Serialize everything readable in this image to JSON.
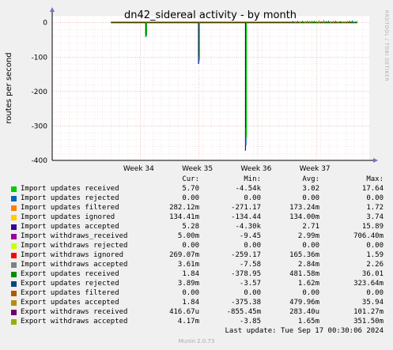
{
  "chart_data": {
    "type": "line",
    "title": "dn42_sidereal activity - by month",
    "ylabel": "routes per second",
    "ylim": [
      -400,
      20
    ],
    "yticks": [
      0,
      -100,
      -200,
      -300,
      -400
    ],
    "xticks": [
      "Week 34",
      "Week 35",
      "Week 36",
      "Week 37"
    ],
    "side_label": "RRDTOOL / TOBI OETIKER",
    "spikes": [
      {
        "week": 34.1,
        "min": -42,
        "colors": [
          "#00cc00",
          "#0066b3",
          "#00cc00"
        ]
      },
      {
        "week": 35.0,
        "min": -120,
        "colors": [
          "#330099",
          "#0066b3",
          "#00cc00"
        ]
      },
      {
        "week": 35.8,
        "min": -372,
        "colors": [
          "#330099",
          "#0066b3",
          "#00cc00"
        ]
      }
    ],
    "baseline_week_start": 33.5,
    "baseline_week_end": 37.7,
    "series": [
      {
        "name": "Import updates received",
        "color": "#00cc00",
        "cur": "5.70",
        "min": "-4.54k",
        "avg": "3.02",
        "max": "17.64"
      },
      {
        "name": "Import updates rejected",
        "color": "#0066b3",
        "cur": "0.00",
        "min": "0.00",
        "avg": "0.00",
        "max": "0.00"
      },
      {
        "name": "Import updates filtered",
        "color": "#ff8000",
        "cur": "282.12m",
        "min": "-271.17",
        "avg": "173.24m",
        "max": "1.72"
      },
      {
        "name": "Import updates ignored",
        "color": "#ffcc00",
        "cur": "134.41m",
        "min": "-134.44",
        "avg": "134.00m",
        "max": "3.74"
      },
      {
        "name": "Import updates accepted",
        "color": "#330099",
        "cur": "5.28",
        "min": "-4.30k",
        "avg": "2.71",
        "max": "15.89"
      },
      {
        "name": "Import withdraws_received",
        "color": "#990099",
        "cur": "5.00m",
        "min": "-9.45",
        "avg": "2.99m",
        "max": "706.40m"
      },
      {
        "name": "Import withdraws rejected",
        "color": "#ccff00",
        "cur": "0.00",
        "min": "0.00",
        "avg": "0.00",
        "max": "0.00"
      },
      {
        "name": "Import withdraws ignored",
        "color": "#ff0000",
        "cur": "269.07m",
        "min": "-259.17",
        "avg": "165.36m",
        "max": "1.59"
      },
      {
        "name": "Import withdraws accepted",
        "color": "#808080",
        "cur": "3.61m",
        "min": "-7.58",
        "avg": "2.84m",
        "max": "2.26"
      },
      {
        "name": "Export updates received",
        "color": "#008f00",
        "cur": "1.84",
        "min": "-378.95",
        "avg": "481.58m",
        "max": "36.01"
      },
      {
        "name": "Export updates rejected",
        "color": "#00487d",
        "cur": "3.89m",
        "min": "-3.57",
        "avg": "1.62m",
        "max": "323.64m"
      },
      {
        "name": "Export updates filtered",
        "color": "#b35a00",
        "cur": "0.00",
        "min": "0.00",
        "avg": "0.00",
        "max": "0.00"
      },
      {
        "name": "Export updates accepted",
        "color": "#b38f00",
        "cur": "1.84",
        "min": "-375.38",
        "avg": "479.96m",
        "max": "35.94"
      },
      {
        "name": "Export withdraws received",
        "color": "#6b006b",
        "cur": "416.67u",
        "min": "-855.45m",
        "avg": "283.40u",
        "max": "101.27m"
      },
      {
        "name": "Export withdraws accepted",
        "color": "#8fb300",
        "cur": "4.17m",
        "min": "-3.85",
        "avg": "1.65m",
        "max": "351.50m"
      }
    ]
  },
  "legend": {
    "col_cur": "Cur:",
    "col_min": "Min:",
    "col_avg": "Avg:",
    "col_max": "Max:"
  },
  "last_update": "Last update: Tue Sep 17 00:30:06 2024",
  "footer": "Munin 2.0.73"
}
